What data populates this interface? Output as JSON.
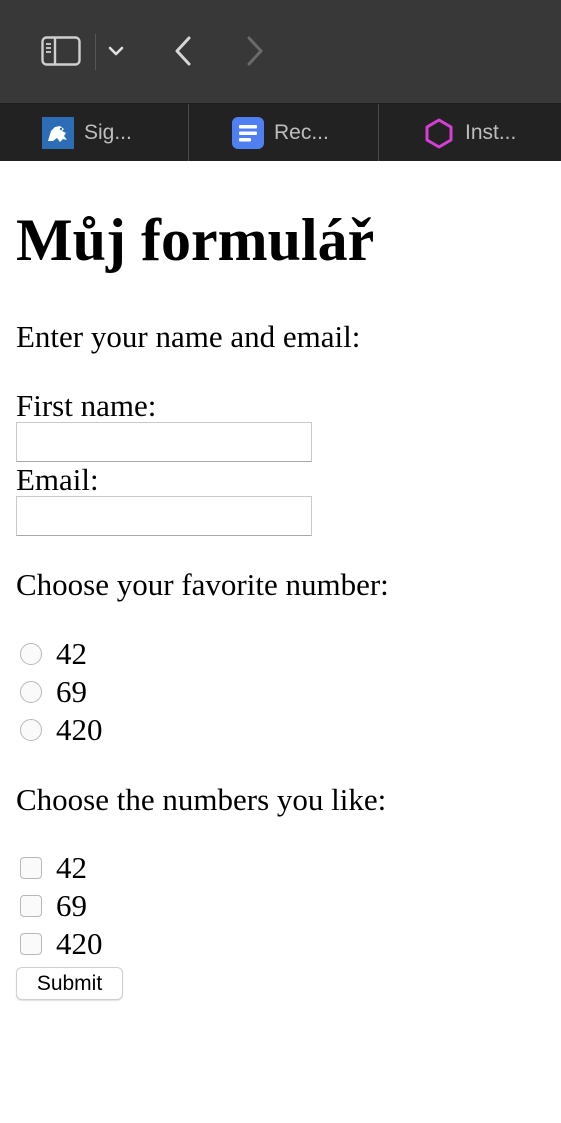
{
  "toolbar": {
    "icons": [
      "sidebar-icon",
      "chevron-down-icon",
      "back-arrow-icon",
      "forward-arrow-icon"
    ]
  },
  "tabs": [
    {
      "label": "Sig...",
      "icon": "university-lion-icon"
    },
    {
      "label": "Rec...",
      "icon": "document-icon"
    },
    {
      "label": "Inst...",
      "icon": "hexagon-icon"
    }
  ],
  "page": {
    "heading": "Můj formulář",
    "intro": "Enter your name and email:",
    "first_name_label": "First name:",
    "first_name_value": "",
    "email_label": "Email:",
    "email_value": "",
    "favorite_prompt": "Choose your favorite number:",
    "favorite_options": [
      "42",
      "69",
      "420"
    ],
    "like_prompt": "Choose the numbers you like:",
    "like_options": [
      "42",
      "69",
      "420"
    ],
    "submit_label": "Submit"
  },
  "colors": {
    "toolbar_bg": "#383838",
    "tabbar_bg": "#222222",
    "tab_doc_blue": "#4f7ff0",
    "tab_hex_magenta": "#d63fd6"
  }
}
